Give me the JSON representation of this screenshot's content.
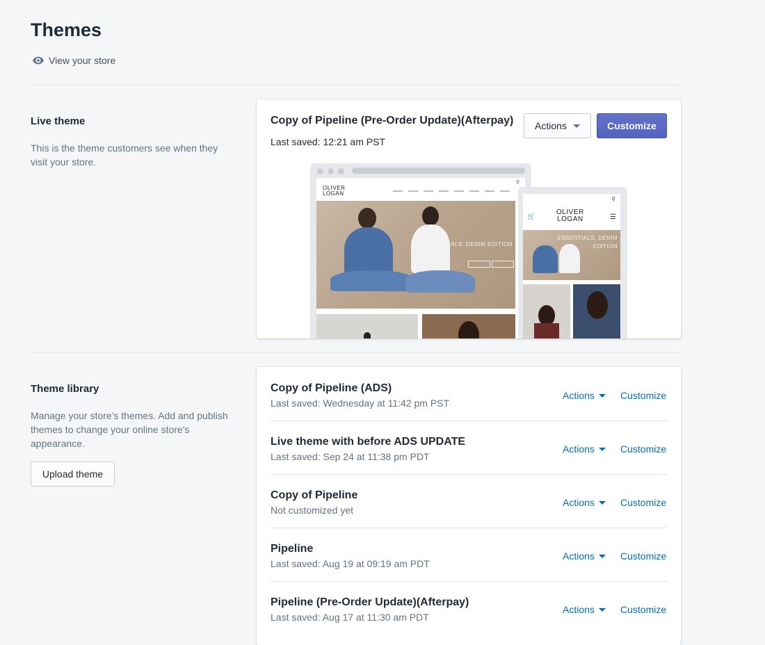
{
  "page": {
    "title": "Themes",
    "view_store_label": "View your store"
  },
  "live_section": {
    "title": "Live theme",
    "description": "This is the theme customers see when they visit your store.",
    "theme_name": "Copy of Pipeline (Pre-Order Update)(Afterpay)",
    "last_saved": "Last saved: 12:21 am PST",
    "actions_label": "Actions",
    "customize_label": "Customize",
    "preview": {
      "desktop_logo_line1": "OLIVER",
      "desktop_logo_line2": "LOGAN",
      "desktop_hero_text": "ESSENTIALS: DENIM EDITION",
      "mobile_logo_line1": "OLIVER",
      "mobile_logo_line2": "LOGAN",
      "mobile_hero_text_line1": "ESSENTIALS: DENIM",
      "mobile_hero_text_line2": "EDITION"
    }
  },
  "library_section": {
    "title": "Theme library",
    "description": "Manage your store's themes. Add and publish themes to change your online store's appearance.",
    "upload_label": "Upload theme",
    "actions_label": "Actions",
    "customize_label": "Customize",
    "themes": [
      {
        "name": "Copy of Pipeline (ADS)",
        "saved": "Last saved: Wednesday at 11:42 pm PST"
      },
      {
        "name": "Live theme with before ADS UPDATE",
        "saved": "Last saved: Sep 24 at 11:38 pm PDT"
      },
      {
        "name": "Copy of Pipeline",
        "saved": "Not customized yet"
      },
      {
        "name": "Pipeline",
        "saved": "Last saved: Aug 19 at 09:19 am PDT"
      },
      {
        "name": "Pipeline (Pre-Order Update)(Afterpay)",
        "saved": "Last saved: Aug 17 at 11:30 am PDT"
      }
    ]
  },
  "colors": {
    "primary_button": "#5c6ac4",
    "link": "#006fbb",
    "background": "#f4f6f8"
  },
  "icons": {
    "view_store": "eye-icon",
    "dropdown": "caret-down-icon",
    "search": "search-icon",
    "cart": "cart-icon",
    "menu": "hamburger-menu-icon"
  }
}
